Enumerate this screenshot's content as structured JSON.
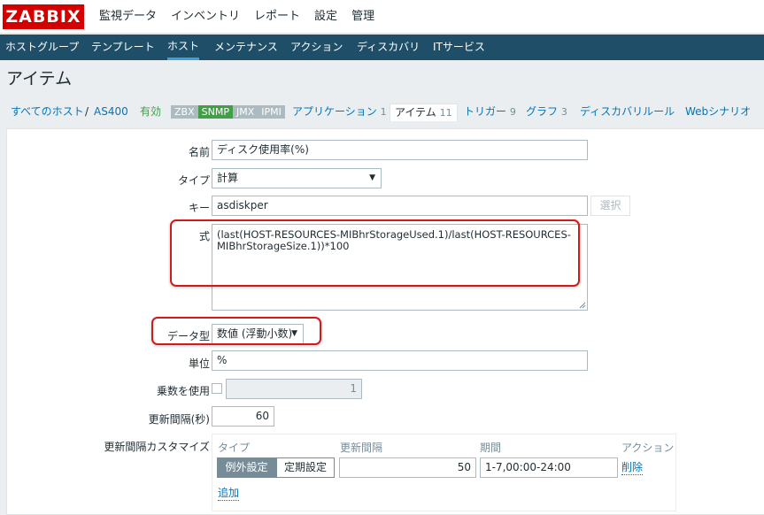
{
  "logo": "ZABBIX",
  "top_menu": [
    "監視データ",
    "インベントリ",
    "レポート",
    "設定",
    "管理"
  ],
  "sub_menu": [
    "ホストグループ",
    "テンプレート",
    "ホスト",
    "メンテナンス",
    "アクション",
    "ディスカバリ",
    "ITサービス"
  ],
  "sub_menu_active": "ホスト",
  "page_title": "アイテム",
  "host_nav": {
    "all_hosts": "すべてのホスト",
    "separator": "/",
    "host": "AS400",
    "status": "有効",
    "badges": [
      "ZBX",
      "SNMP",
      "JMX",
      "IPMI"
    ],
    "tabs": [
      {
        "label": "アプリケーション",
        "count": "1"
      },
      {
        "label": "アイテム",
        "count": "11"
      },
      {
        "label": "トリガー",
        "count": "9"
      },
      {
        "label": "グラフ",
        "count": "3"
      },
      {
        "label": "ディスカバリルール",
        "count": ""
      },
      {
        "label": "Webシナリオ",
        "count": ""
      }
    ],
    "colors": {
      "enabled": "#429e47",
      "snmp_badge": "#429e47",
      "inactive_badge": "#acbbc2"
    }
  },
  "form": {
    "name_label": "名前",
    "name_value": "ディスク使用率(%)",
    "type_label": "タイプ",
    "type_value": "計算",
    "key_label": "キー",
    "key_value": "asdiskper",
    "select_button": "選択",
    "formula_label": "式",
    "formula_line1": "(last(HOST-RESOURCES-MIBhrStorageUsed.1)/last(HOST-RESOURCES-",
    "formula_line2": "MIBhrStorageSize.1))*100",
    "datatype_label": "データ型",
    "datatype_value": "数値 (浮動小数)",
    "units_label": "単位",
    "units_value": "%",
    "multiplier_label": "乗数を使用",
    "multiplier_value": "1",
    "interval_label": "更新間隔(秒)",
    "interval_value": "60",
    "custom_label": "更新間隔カスタマイズ",
    "custom": {
      "col_type": "タイプ",
      "col_interval": "更新間隔",
      "col_period": "期間",
      "col_action": "アクション",
      "seg_flexible": "例外設定",
      "seg_scheduling": "定期設定",
      "row_interval": "50",
      "row_period": "1-7,00:00-24:00",
      "remove": "削除",
      "add": "追加"
    },
    "highlight_color": "#d11a1a"
  }
}
